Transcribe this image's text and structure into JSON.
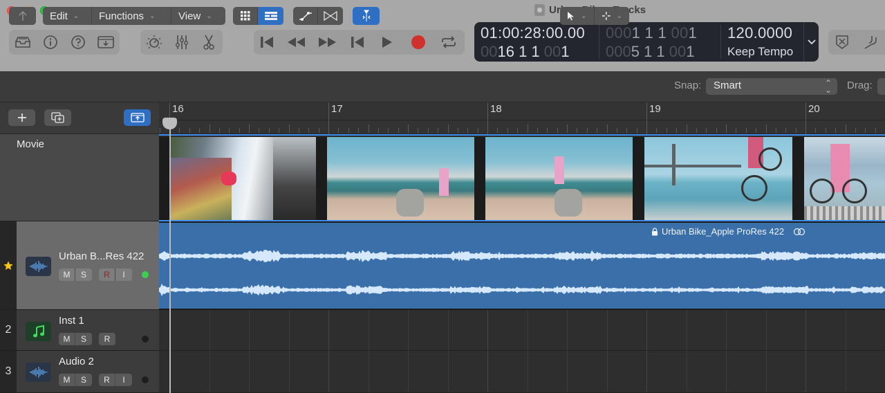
{
  "window": {
    "title": "Urban Bike - Tracks"
  },
  "toolbar": {
    "left_group": [
      "library-icon",
      "inspector-icon",
      "quick-help-icon",
      "download-icon"
    ],
    "mid_group": [
      "smart-controls-icon",
      "mixer-icon",
      "editors-scissors-icon"
    ],
    "transport": [
      "go-to-beginning-icon",
      "rewind-icon",
      "fast-forward-icon",
      "go-to-start-icon",
      "play-icon",
      "record-icon",
      "cycle-icon"
    ],
    "right_group": [
      "list-editors-icon",
      "tuner-icon"
    ],
    "record_color": "#d0312d"
  },
  "lcd": {
    "timecode": "01:00:28:00.00",
    "bars_pos": {
      "dim": "00",
      "bright": "16  1  1",
      "dim2": " 00",
      "bright2": "1"
    },
    "locator_start": {
      "dim": "000",
      "bright": "1  1  1",
      "dim2": " 00",
      "bright2": "1"
    },
    "locator_end": {
      "dim": "000",
      "bright": "5  1  1",
      "dim2": " 00",
      "bright2": "1"
    },
    "tempo": "120.0000",
    "tempo_mode": "Keep Tempo"
  },
  "toolbar2": {
    "edit": "Edit",
    "functions": "Functions",
    "view": "View",
    "snap_label": "Snap:",
    "snap_value": "Smart",
    "drag_label": "Drag:"
  },
  "ruler": {
    "bars": [
      "16",
      "17",
      "18",
      "19",
      "20"
    ]
  },
  "movie": {
    "label": "Movie"
  },
  "tracks": [
    {
      "number": "",
      "name": "Urban B...Res 422",
      "type": "audio",
      "buttons": [
        "M",
        "S",
        "R",
        "I"
      ],
      "favorite": true,
      "selected": true,
      "led_color": "#3ccf4e"
    },
    {
      "number": "2",
      "name": "Inst 1",
      "type": "instrument",
      "buttons": [
        "M",
        "S",
        "R"
      ],
      "favorite": false,
      "selected": false,
      "led_color": "#1e1e1e"
    },
    {
      "number": "3",
      "name": "Audio 2",
      "type": "audio",
      "buttons": [
        "M",
        "S",
        "R",
        "I"
      ],
      "favorite": false,
      "selected": false,
      "led_color": "#1e1e1e"
    }
  ],
  "region": {
    "title": "Urban Bike_Apple ProRes 422",
    "color": "#3a6fa9"
  }
}
